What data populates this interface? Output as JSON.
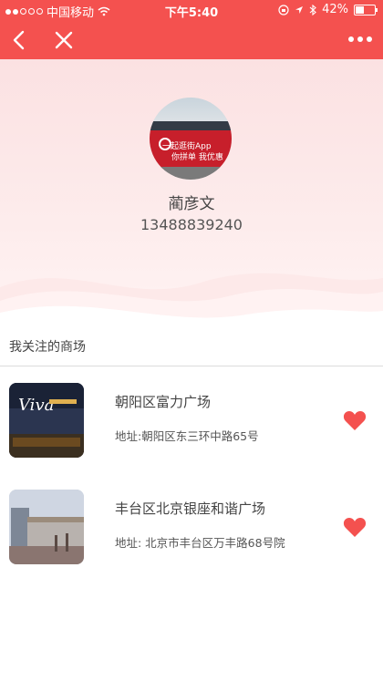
{
  "status_bar": {
    "carrier": "中国移动",
    "time": "下午5:40",
    "battery": "42%",
    "battery_level": 0.42
  },
  "nav": {
    "back_icon": "chevron-left-icon",
    "close_icon": "close-icon",
    "more_icon": "more-dots-icon"
  },
  "profile": {
    "avatar_line1": "一起逛街App",
    "avatar_line2": "你拼单 我优惠",
    "name": "蔺彦文",
    "phone": "13488839240"
  },
  "section": {
    "title": "我关注的商场"
  },
  "malls": [
    {
      "name": "朝阳区富力广场",
      "address": "地址:朝阳区东三环中路65号",
      "thumb_text": "Viva",
      "favorite_color": "#f4514f"
    },
    {
      "name": "丰台区北京银座和谐广场",
      "address": "地址: 北京市丰台区万丰路68号院",
      "favorite_color": "#f4514f"
    }
  ],
  "colors": {
    "brand": "#f4514f",
    "header_bg": "#fbe1e2"
  }
}
